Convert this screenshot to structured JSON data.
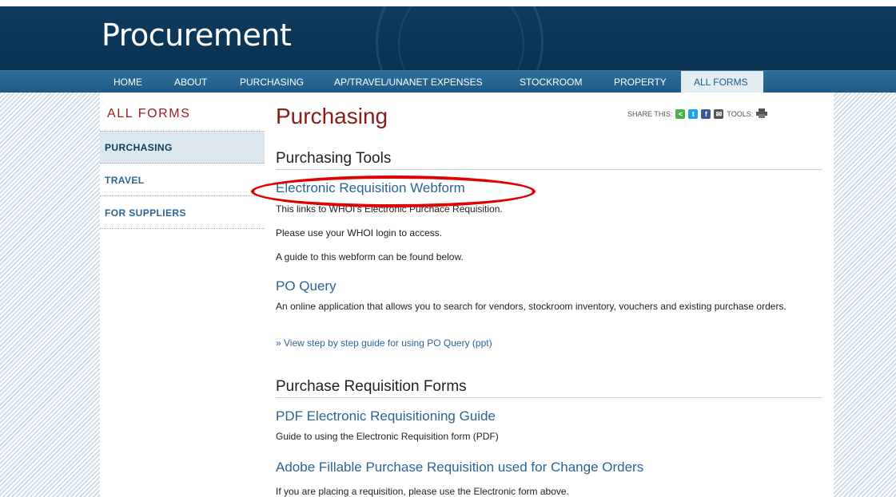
{
  "header": {
    "title": "Procurement"
  },
  "nav": {
    "items": [
      {
        "label": "HOME"
      },
      {
        "label": "ABOUT"
      },
      {
        "label": "PURCHASING"
      },
      {
        "label": "AP/TRAVEL/UNANET EXPENSES"
      },
      {
        "label": "STOCKROOM"
      },
      {
        "label": "PROPERTY"
      },
      {
        "label": "ALL FORMS",
        "active": true
      }
    ]
  },
  "sidebar": {
    "heading": "ALL FORMS",
    "items": [
      {
        "label": "PURCHASING",
        "active": true
      },
      {
        "label": "TRAVEL"
      },
      {
        "label": "FOR SUPPLIERS"
      }
    ]
  },
  "main": {
    "page_title": "Purchasing",
    "share": {
      "share_label": "SHARE THIS:",
      "tools_label": "TOOLS:",
      "icons": [
        "share-icon",
        "twitter-icon",
        "facebook-icon",
        "email-icon",
        "print-icon"
      ]
    },
    "tools_section": {
      "heading": "Purchasing Tools",
      "webform": {
        "title": "Electronic Requisition Webform",
        "lines": [
          "This links to WHOI's Electronic Purchace Requisition.",
          "Please use your WHOI login to access.",
          "A guide to this webform can be found below."
        ]
      },
      "po_query": {
        "title": "PO Query",
        "description": "An online application that allows you to search for vendors, stockroom inventory, vouchers and existing purchase orders.",
        "guide_link": "» View step by step guide for using PO Query (ppt)"
      }
    },
    "forms_section": {
      "heading": "Purchase Requisition Forms",
      "pdf_guide": {
        "title": "PDF Electronic Requisitioning Guide",
        "description": "Guide to using the Electronic Requisition form (PDF)"
      },
      "adobe_form": {
        "title": "Adobe Fillable Purchase Requisition used for Change Orders",
        "description": "If you are placing a requisition, please use the Electronic form above."
      }
    }
  },
  "colors": {
    "header_bg": "#0f3c5f",
    "nav_bg": "#1f5a85",
    "title_red": "#8b1a1a",
    "link_blue": "#2a6496",
    "highlight_oval": "#e10000"
  }
}
